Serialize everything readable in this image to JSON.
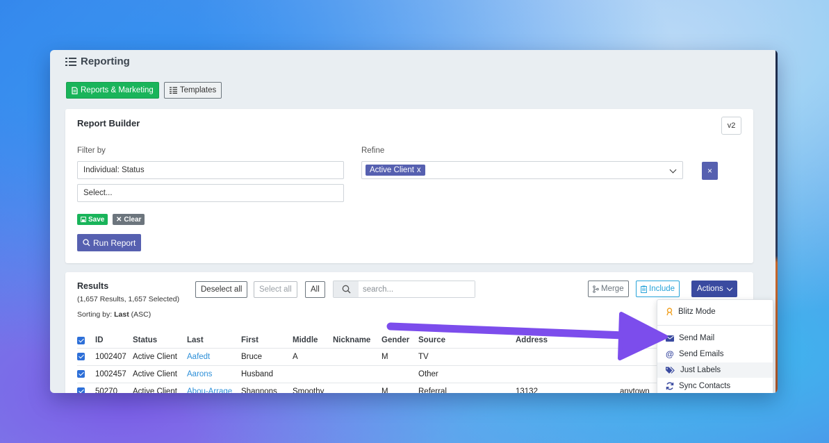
{
  "header": {
    "title": "Reporting",
    "icon": "list-icon"
  },
  "tabs": [
    {
      "label": "Reports & Marketing",
      "icon": "document-icon",
      "active": true
    },
    {
      "label": "Templates",
      "icon": "table-icon",
      "active": false
    }
  ],
  "builder": {
    "title": "Report Builder",
    "version_label": "v2",
    "filter_label": "Filter by",
    "filter_value": "Individual: Status",
    "filter_second_placeholder": "Select...",
    "refine_label": "Refine",
    "refine_chip": "Active Client",
    "refine_chip_remove": "x",
    "remove_button": "×",
    "save_label": "Save",
    "clear_label": "Clear",
    "run_label": "Run Report"
  },
  "results": {
    "title": "Results",
    "summary": "(1,657 Results, 1,657 Selected)",
    "sorting_prefix": "Sorting by:",
    "sorting_field": "Last",
    "sorting_dir": "(ASC)",
    "deselect_all": "Deselect all",
    "select_all": "Select all",
    "all": "All",
    "search_placeholder": "search...",
    "merge": "Merge",
    "include": "Include",
    "actions": "Actions",
    "columns": [
      "ID",
      "Status",
      "Last",
      "First",
      "Middle",
      "Nickname",
      "Gender",
      "Source",
      "Address"
    ],
    "rows": [
      {
        "id": "1002407",
        "status": "Active Client",
        "last": "Aafedt",
        "first": "Bruce",
        "middle": "A",
        "nickname": "",
        "gender": "M",
        "source": "TV",
        "address": "",
        "extra": ""
      },
      {
        "id": "1002457",
        "status": "Active Client",
        "last": "Aarons",
        "first": "Husband",
        "middle": "",
        "nickname": "",
        "gender": "",
        "source": "Other",
        "address": "",
        "extra": ""
      },
      {
        "id": "50270",
        "status": "Active Client",
        "last": "Abou-Arrage",
        "first": "Shannons",
        "middle": "Smoothy",
        "nickname": "",
        "gender": "M",
        "source": "Referral",
        "address": "13132",
        "extra": "anytown"
      }
    ]
  },
  "actions_menu": [
    {
      "label": "Blitz Mode",
      "icon": "user-badge-icon",
      "color": "#f0a020"
    },
    {
      "label": "Send Mail",
      "icon": "envelope-icon",
      "color": "#3a4aa0"
    },
    {
      "label": "Send Emails",
      "icon": "at-icon",
      "color": "#3a4aa0"
    },
    {
      "label": "Just Labels",
      "icon": "tags-icon",
      "color": "#3a4aa0"
    },
    {
      "label": "Sync Contacts",
      "icon": "sync-icon",
      "color": "#3a4aa0"
    }
  ],
  "colors": {
    "primary": "#5660b0",
    "success": "#19b45a",
    "info": "#27a3d9",
    "arrow": "#7c4dec"
  }
}
